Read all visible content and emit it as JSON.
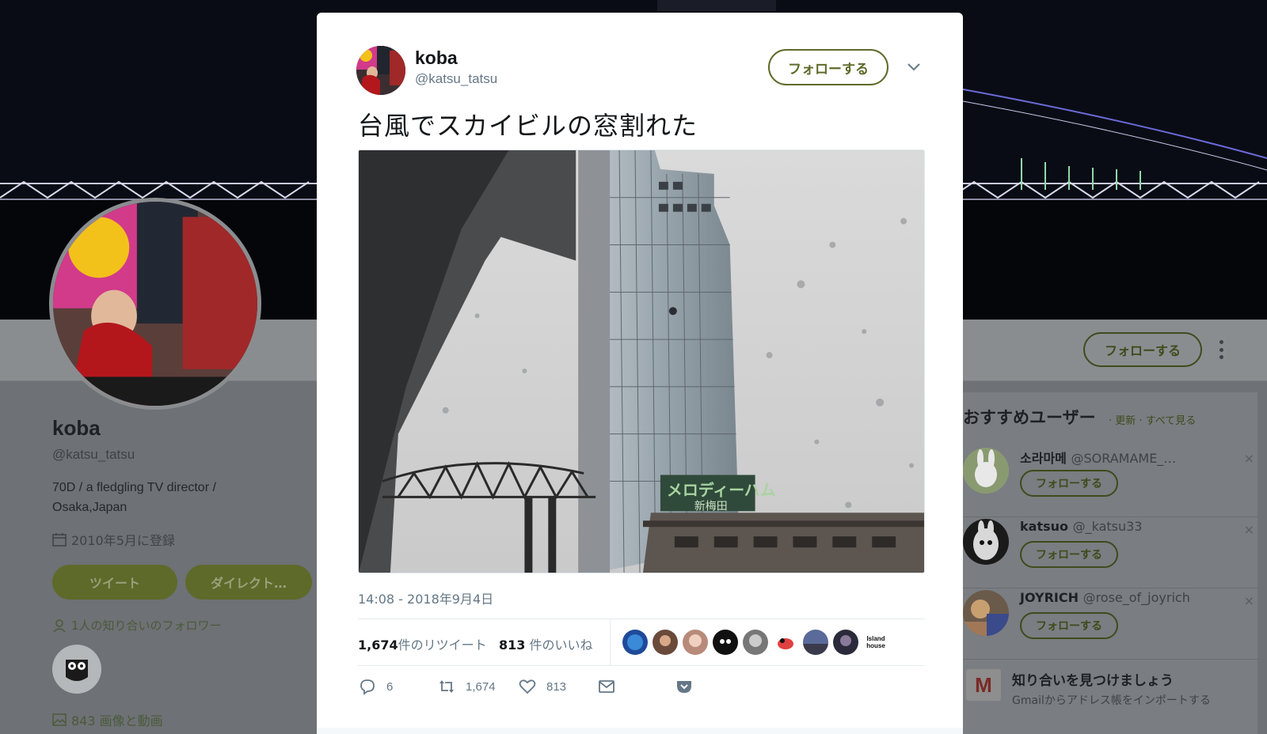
{
  "background_profile": {
    "name": "koba",
    "handle": "@katsu_tatsu",
    "bio": "70D / a fledgling TV director / Osaka,Japan",
    "joined": "2010年5月に登録",
    "tweet_button": "ツイート",
    "direct_button": "ダイレクト…",
    "followers_known": "1人の知り合いのフォロワー",
    "media_count": "843 画像と動画",
    "follow_button": "フォローする"
  },
  "suggestions": {
    "title": "おすすめユーザー",
    "links": "· 更新 · すべて見る",
    "users": [
      {
        "name": "소라마메",
        "handle": "@SORAMAME_…",
        "follow": "フォローする"
      },
      {
        "name": "katsuo",
        "handle": "@_katsu33",
        "follow": "フォローする"
      },
      {
        "name": "JOYRICH",
        "handle": "@rose_of_joyrich",
        "follow": "フォローする"
      }
    ],
    "close_symbol": "×",
    "find_friends_title": "知り合いを見つけましょう",
    "find_friends_sub": "Gmailからアドレス帳をインポートする",
    "gmail_letter": "M"
  },
  "tweet": {
    "name": "koba",
    "handle": "@katsu_tatsu",
    "follow_button": "フォローする",
    "text": "台風でスカイビルの窓割れた",
    "timestamp": "14:08 - 2018年9月4日",
    "retweets_count": "1,674",
    "retweets_label": "件のリツイート",
    "likes_count": "813",
    "likes_label": "件のいいね",
    "last_liker_label": "Island house",
    "actions": {
      "reply_count": "6",
      "retweet_count": "1,674",
      "like_count": "813"
    },
    "photo_sign": "メロディーハム",
    "photo_sign2": "新梅田"
  },
  "colors": {
    "accent_olive": "#5e6a2a",
    "muted_text": "#657786",
    "overlay_bg": "#6e7175"
  },
  "icons": [
    "calendar-icon",
    "person-icon",
    "image-icon",
    "chevron-down-icon",
    "reply-icon",
    "retweet-icon",
    "heart-icon",
    "mail-icon",
    "pocket-icon",
    "more-vertical-icon",
    "gmail-icon"
  ]
}
